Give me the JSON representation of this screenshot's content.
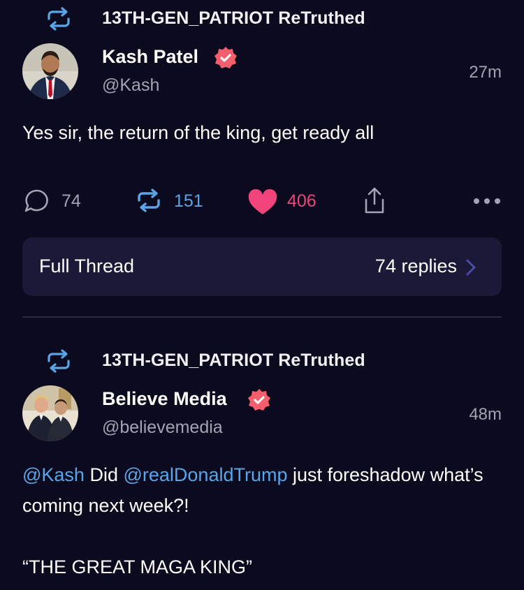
{
  "colors": {
    "background": "#0b0a1e",
    "accent_blue": "#58a6e8",
    "like_pink": "#f0447a",
    "verified_badge": "#f35d6c",
    "muted_text": "#a3a3b5",
    "card_background": "#1a1938"
  },
  "posts": [
    {
      "retruth_label": "13TH-GEN_PATRIOT ReTruthed",
      "retruth_icon": "retruth-icon",
      "author": {
        "name": "Kash Patel",
        "handle": "@Kash",
        "verified": true,
        "avatar": "avatar-photo"
      },
      "timestamp": "27m",
      "body": "Yes sir, the return of the king, get ready all",
      "actions": {
        "replies": "74",
        "retruths": "151",
        "likes": "406",
        "reply_icon": "speech-bubble-icon",
        "retruth_icon": "retruth-icon",
        "like_icon": "heart-icon",
        "share_icon": "share-icon",
        "more_icon": "more-dots-icon"
      },
      "thread": {
        "label": "Full Thread",
        "replies_label": "74 replies",
        "chevron_icon": "chevron-right-icon"
      }
    },
    {
      "retruth_label": "13TH-GEN_PATRIOT ReTruthed",
      "retruth_icon": "retruth-icon",
      "author": {
        "name": "Believe Media",
        "handle": "@believemedia",
        "verified": true,
        "avatar": "avatar-photo"
      },
      "timestamp": "48m",
      "body": {
        "mention1": "@Kash",
        "text1": " Did ",
        "mention2": "@realDonaldTrump",
        "text2": " just foreshadow what’s coming next week?!",
        "quote": "“THE GREAT MAGA KING”"
      }
    }
  ]
}
